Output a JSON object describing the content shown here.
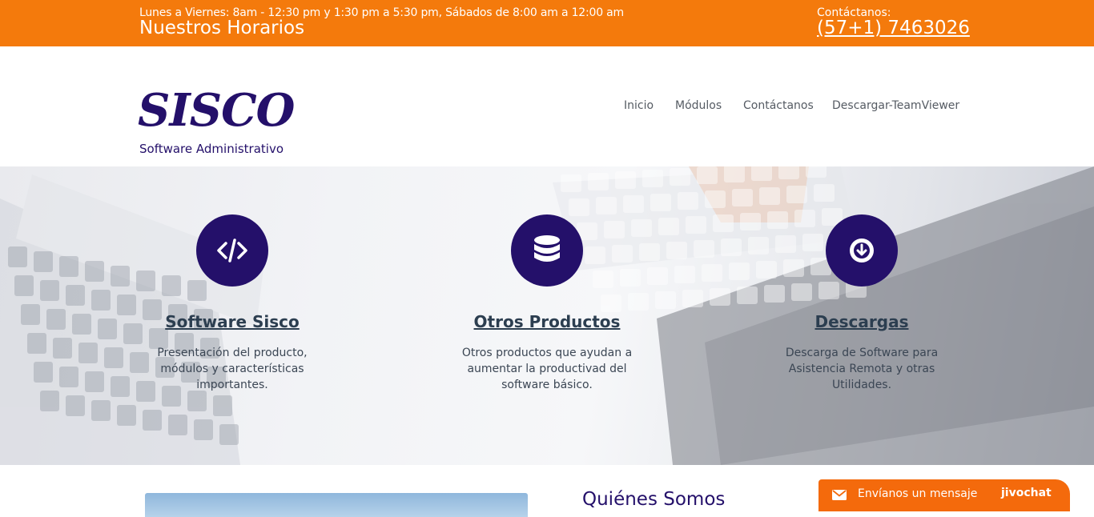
{
  "topbar": {
    "hours_detail": "Lunes a Viernes: 8am - 12:30 pm y 1:30 pm a 5:30 pm, Sábados de 8:00 am a 12:00 am",
    "hours_title": "Nuestros Horarios",
    "contact_label": "Contáctanos:",
    "contact_phone": "(57+1) 7463026"
  },
  "header": {
    "logo": "SISCO",
    "tagline": "Software Administrativo",
    "nav": [
      "Inicio",
      "Módulos",
      "Contáctanos",
      "Descargar-TeamViewer"
    ]
  },
  "features": [
    {
      "icon": "code-icon",
      "title": "Software Sisco",
      "description": "Presentación del producto, módulos y características importantes."
    },
    {
      "icon": "database-icon",
      "title": "Otros Productos",
      "description": "Otros productos que ayudan a aumentar la productivad del software básico."
    },
    {
      "icon": "download-circle-icon",
      "title": "Descargas",
      "description": "Descarga de Software para Asistencia Remota y otras Utilidades."
    }
  ],
  "about": {
    "title": "Quiénes Somos"
  },
  "chat": {
    "label": "Envíanos un mensaje",
    "brand": "jivochat",
    "icon": "mail-icon"
  },
  "colors": {
    "topbar": "#f47a0c",
    "brand": "#24106a",
    "chat": "#f46a0c",
    "heading": "#2c3e50"
  }
}
